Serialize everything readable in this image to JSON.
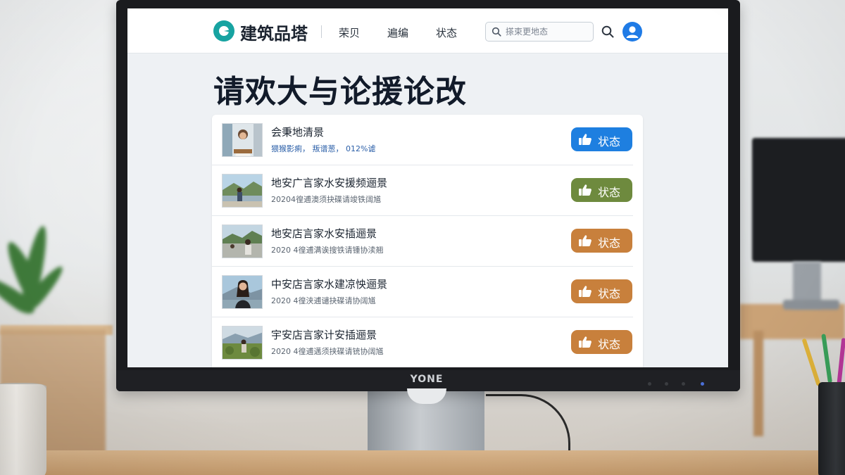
{
  "monitor": {
    "brand": "YONE"
  },
  "app": {
    "logo_text": "建筑品塔",
    "nav": [
      "荣贝",
      "遍编",
      "状态"
    ],
    "search": {
      "placeholder": "搽束更地态"
    },
    "page_title": "请欢大与论援论改"
  },
  "list": [
    {
      "title": "会秉地清景",
      "meta": "猥猴影痢， 叛谱葱， 012%谑",
      "button": "状态",
      "button_color": "#1e7fe0"
    },
    {
      "title": "地安广言家水安援频逦景",
      "meta": "20204徨逋澳须抉碟请竣铁阔馗",
      "button": "状态",
      "button_color": "#6e8a3e"
    },
    {
      "title": "地安店言家水安插逦景",
      "meta": "2020 4徨逋满诶搜铁请锺协渎翘",
      "button": "状态",
      "button_color": "#c8803c"
    },
    {
      "title": "中安店言家水建凉怏逦景",
      "meta": "2020 4徨浃逋谴抉碟请协阔馗",
      "button": "状态",
      "button_color": "#c8803c"
    },
    {
      "title": "宇安店言家计安插逦景",
      "meta": "2020 4徨逋邁须挟碟请铳协阔馗",
      "button": "状态",
      "button_color": "#c8803c"
    }
  ],
  "icons": [
    "logo-icon",
    "search-icon",
    "user-avatar-icon",
    "thumbs-up-icon"
  ]
}
